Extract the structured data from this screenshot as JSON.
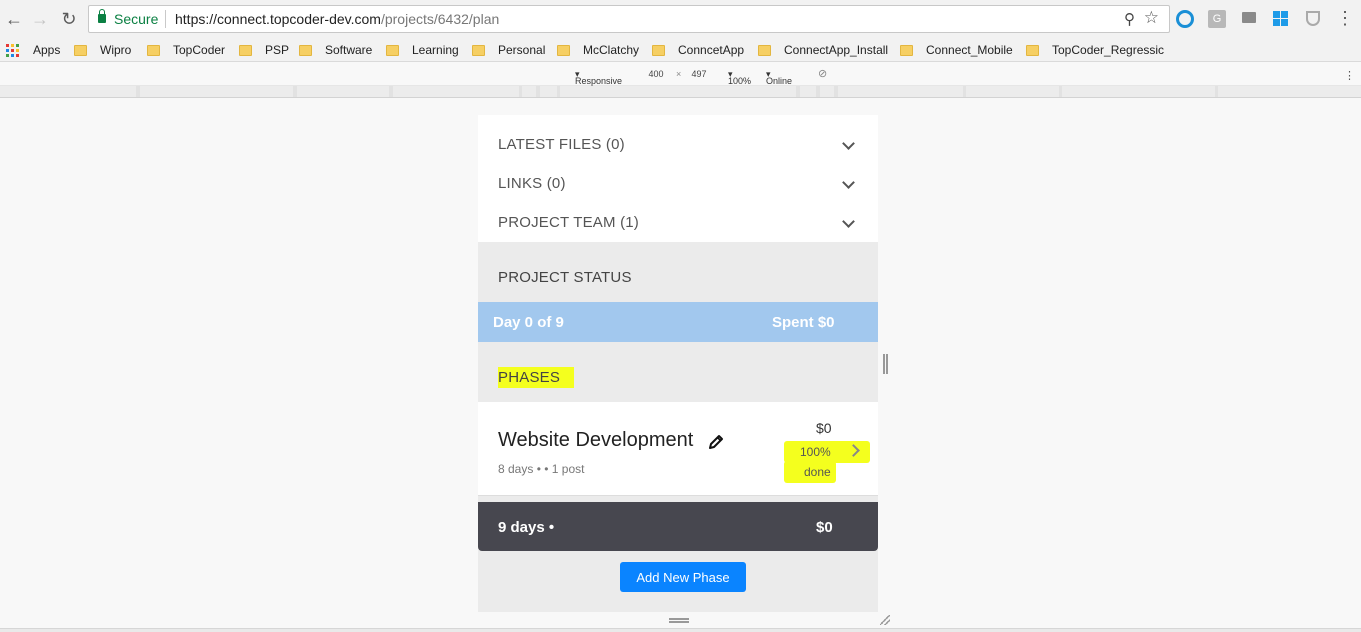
{
  "browser": {
    "secure_label": "Secure",
    "url_base": "https://connect.topcoder-dev.com",
    "url_path": "/projects/6432/plan",
    "icons": [
      "back-icon",
      "forward-icon",
      "reload-icon",
      "zoom-icon",
      "star-icon",
      "menu-icon"
    ]
  },
  "bookmarks": [
    {
      "label": "Apps",
      "icon": "apps-grid-icon"
    },
    {
      "label": "Wipro",
      "icon": "folder-icon"
    },
    {
      "label": "TopCoder",
      "icon": "folder-icon"
    },
    {
      "label": "PSP",
      "icon": "folder-icon"
    },
    {
      "label": "Software",
      "icon": "folder-icon"
    },
    {
      "label": "Learning",
      "icon": "folder-icon"
    },
    {
      "label": "Personal",
      "icon": "folder-icon"
    },
    {
      "label": "McClatchy",
      "icon": "folder-icon"
    },
    {
      "label": "ConncetApp",
      "icon": "folder-icon"
    },
    {
      "label": "ConnectApp_Install",
      "icon": "folder-icon"
    },
    {
      "label": "Connect_Mobile",
      "icon": "folder-icon"
    },
    {
      "label": "TopCoder_Regressic",
      "icon": "folder-icon"
    }
  ],
  "devtools": {
    "device_mode": "Responsive",
    "width": "400",
    "times": "×",
    "height": "497",
    "zoom": "100%",
    "network": "Online"
  },
  "sidebar": {
    "accordions": [
      {
        "label": "LATEST FILES (0)"
      },
      {
        "label": "LINKS (0)"
      },
      {
        "label": "PROJECT TEAM (1)"
      }
    ],
    "project_status_heading": "PROJECT STATUS",
    "status": {
      "day": "Day 0 of 9",
      "spent": "Spent $0"
    },
    "phases_heading": "PHASES",
    "phase": {
      "name": "Website Development",
      "meta": "8 days •  • 1 post",
      "budget": "$0",
      "progress": "100%",
      "progress_status": "done"
    },
    "total": {
      "days": "9 days •",
      "amount": "$0"
    },
    "add_phase_label": "Add New Phase"
  },
  "colors": {
    "accent": "#0a84ff",
    "status_bar": "#a2c8ee",
    "total_bar": "#47474f",
    "highlight": "#f4ff1e"
  }
}
